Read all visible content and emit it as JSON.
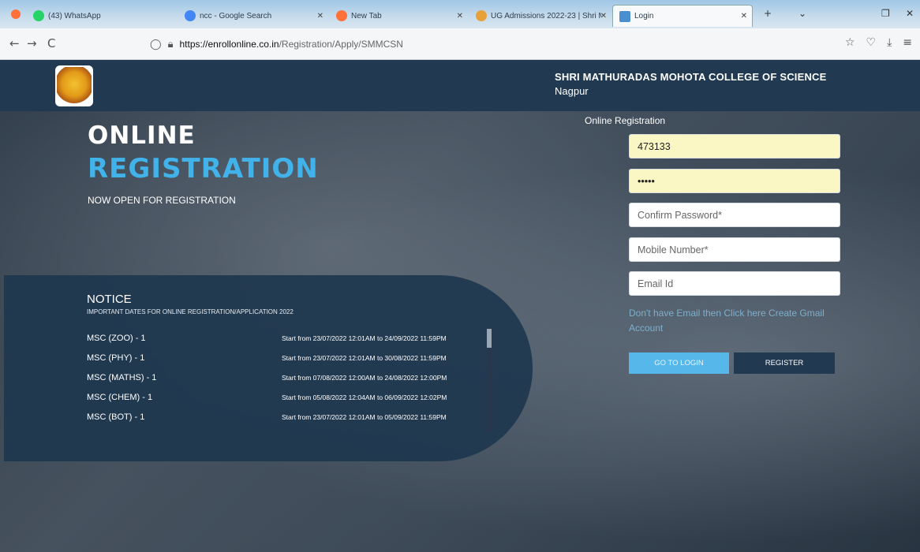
{
  "browser": {
    "tabs": [
      {
        "label": "(43) WhatsApp",
        "color": "#25d366"
      },
      {
        "label": "ncc - Google Search",
        "color": "#4285f4"
      },
      {
        "label": "New Tab",
        "color": "#ff7139"
      },
      {
        "label": "UG Admissions 2022-23 | Shri M...",
        "color": "#e8a13a"
      },
      {
        "label": "Login",
        "color": "#4a8fd0"
      }
    ],
    "url_host": "https://enrollonline.co.in",
    "url_path": "/Registration/Apply/SMMCSN"
  },
  "header": {
    "college_name": "SHRI MATHURADAS MOHOTA COLLEGE OF SCIENCE",
    "city": "Nagpur"
  },
  "hero": {
    "title_line1": "ONLINE",
    "title_line2": "REGISTRATION",
    "subtitle": "NOW OPEN FOR REGISTRATION"
  },
  "notice": {
    "title": "NOTICE",
    "subtitle": "IMPORTANT DATES FOR ONLINE REGISTRATION/APPLICATION 2022",
    "items": [
      {
        "course": "MSC (ZOO) - 1",
        "dates": "Start from 23/07/2022 12:01AM to 24/09/2022 11:59PM"
      },
      {
        "course": "MSC (PHY) - 1",
        "dates": "Start from 23/07/2022 12:01AM to 30/08/2022 11:59PM"
      },
      {
        "course": "MSC (MATHS) - 1",
        "dates": "Start from 07/08/2022 12:00AM to 24/08/2022 12:00PM"
      },
      {
        "course": "MSC (CHEM) - 1",
        "dates": "Start from 05/08/2022 12:04AM to 06/09/2022 12:02PM"
      },
      {
        "course": "MSC (BOT) - 1",
        "dates": "Start from 23/07/2022 12:01AM to 05/09/2022 11:59PM"
      }
    ]
  },
  "form": {
    "title": "Online Registration",
    "username_value": "473133",
    "password_value": "•••••",
    "confirm_placeholder": "Confirm Password*",
    "mobile_placeholder": "Mobile Number*",
    "email_placeholder": "Email Id",
    "hint": "Don't have Email then Click here Create Gmail Account",
    "login_label": "GO TO LOGIN",
    "register_label": "REGISTER"
  }
}
